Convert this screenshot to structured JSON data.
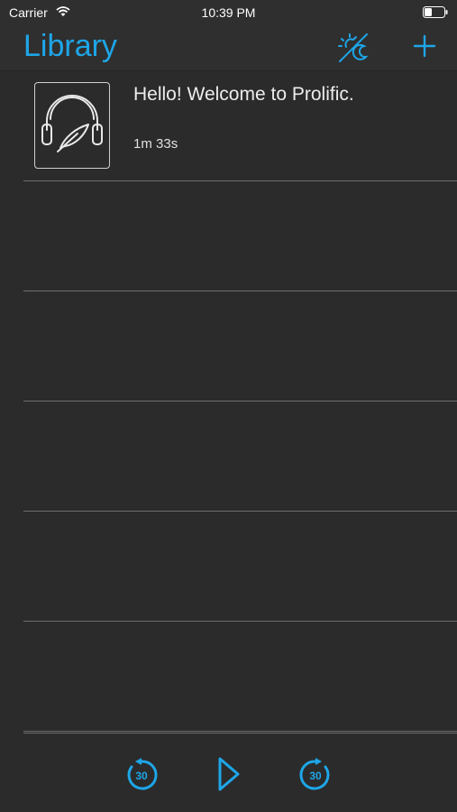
{
  "status": {
    "carrier": "Carrier",
    "time": "10:39 PM"
  },
  "nav": {
    "title": "Library",
    "theme_icon": "sun-moon-icon",
    "add_icon": "plus-icon"
  },
  "library": {
    "items": [
      {
        "title": "Hello! Welcome to Prolific.",
        "duration": "1m 33s",
        "icon": "headphones-feather-icon"
      }
    ]
  },
  "player": {
    "skip_back_label": "30",
    "skip_forward_label": "30",
    "play_icon": "play-icon"
  },
  "colors": {
    "accent": "#1ea6e8",
    "background": "#2b2b2b",
    "bar": "#2f2f2f",
    "divider": "#6d6d6d",
    "text": "#ececec"
  }
}
